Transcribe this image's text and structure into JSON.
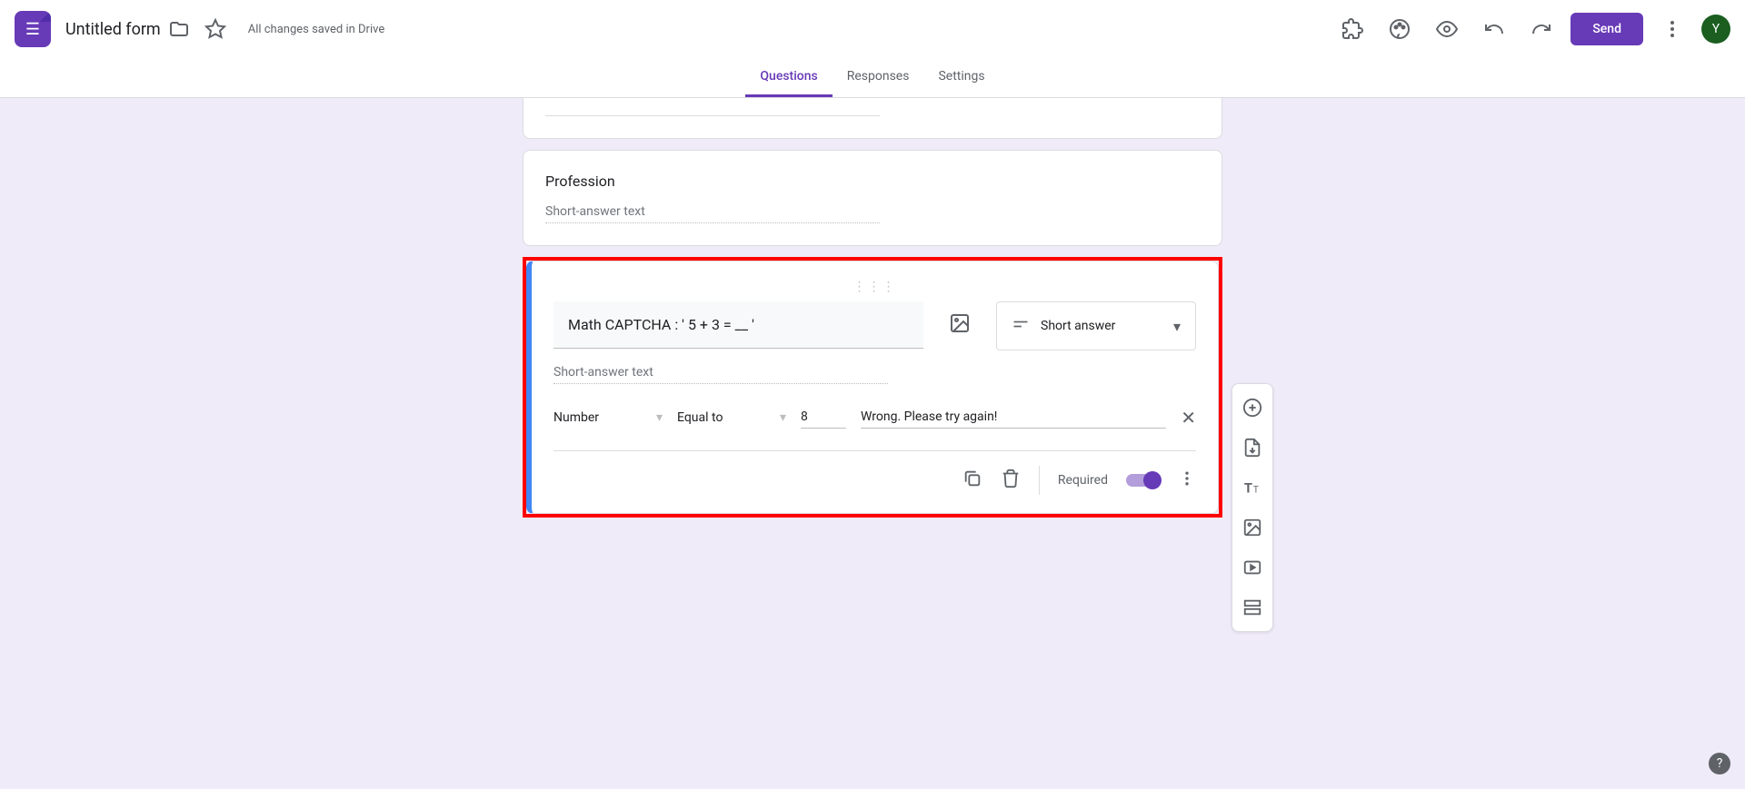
{
  "header": {
    "title": "Untitled form",
    "save_status": "All changes saved in Drive",
    "send_label": "Send",
    "avatar_letter": "Y"
  },
  "tabs": {
    "questions": "Questions",
    "responses": "Responses",
    "settings": "Settings"
  },
  "card_profession": {
    "title": "Profession",
    "placeholder": "Short-answer text"
  },
  "active_card": {
    "question_text": "Math CAPTCHA : ' 5 + 3 = __ '",
    "answer_placeholder": "Short-answer text",
    "type_label": "Short answer",
    "validation": {
      "type": "Number",
      "condition": "Equal to",
      "value": "8",
      "error_text": "Wrong. Please try again!"
    },
    "required_label": "Required"
  }
}
